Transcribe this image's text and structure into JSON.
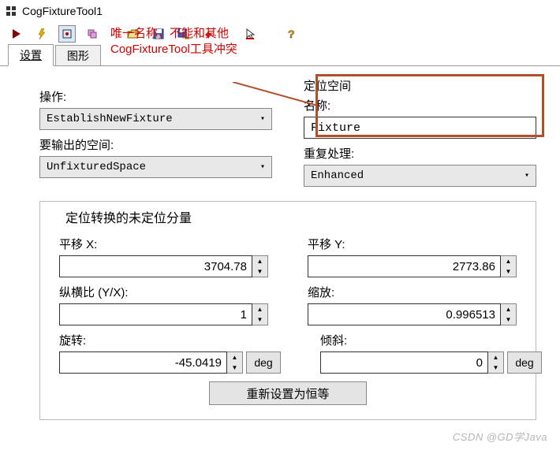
{
  "window": {
    "title": "CogFixtureTool1"
  },
  "tabs": {
    "tab1": "设置",
    "tab2": "图形"
  },
  "annotation": {
    "line1": "唯一名称，不能和其他",
    "line2": "CogFixtureTool工具冲突"
  },
  "left": {
    "op_label": "操作:",
    "op_value": "EstablishNewFixture",
    "outspace_label": "要输出的空间:",
    "outspace_value": "UnfixturedSpace"
  },
  "right": {
    "group": "定位空间",
    "name_label": "名称:",
    "name_value": "Fixture",
    "repeat_label": "重复处理:",
    "repeat_value": "Enhanced"
  },
  "group": {
    "title": "定位转换的未定位分量",
    "tx_label": "平移 X:",
    "tx_value": "3704.78",
    "ty_label": "平移 Y:",
    "ty_value": "2773.86",
    "aspect_label": "纵横比 (Y/X):",
    "aspect_value": "1",
    "scale_label": "缩放:",
    "scale_value": "0.996513",
    "rot_label": "旋转:",
    "rot_value": "-45.0419",
    "skew_label": "倾斜:",
    "skew_value": "0",
    "deg": "deg",
    "reset": "重新设置为恒等"
  },
  "watermark": "CSDN @GD学Java"
}
